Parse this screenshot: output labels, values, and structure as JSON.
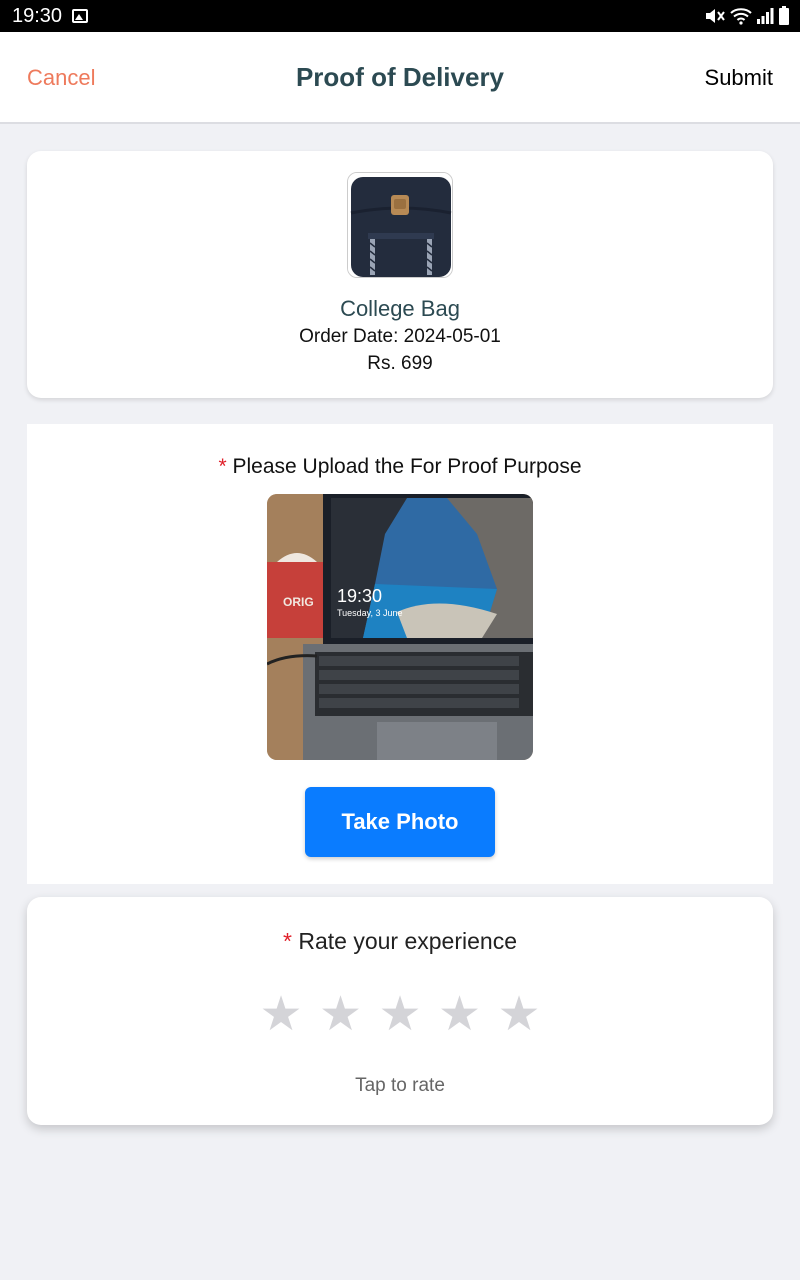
{
  "status_bar": {
    "time": "19:30"
  },
  "header": {
    "cancel_label": "Cancel",
    "title": "Proof of Delivery",
    "submit_label": "Submit"
  },
  "product": {
    "name": "College Bag",
    "order_date_label": "Order Date: 2024-05-01",
    "price_label": "Rs. 699",
    "image_icon": "backpack-image"
  },
  "upload": {
    "required_mark": "*",
    "label": "Please Upload the For Proof Purpose",
    "photo_time": "19:30",
    "photo_date": "Tuesday, 3 June",
    "photo_brand": "ORIG",
    "button_label": "Take Photo"
  },
  "rating": {
    "required_mark": "*",
    "title": "Rate your experience",
    "stars": [
      "★",
      "★",
      "★",
      "★",
      "★"
    ],
    "value": 0,
    "max": 5,
    "hint": "Tap to rate"
  },
  "colors": {
    "accent": "#0a7cff",
    "cancel": "#ee7a5c",
    "title": "#2c4a52",
    "required": "#e0202a",
    "star_empty": "#d4d4d8"
  }
}
